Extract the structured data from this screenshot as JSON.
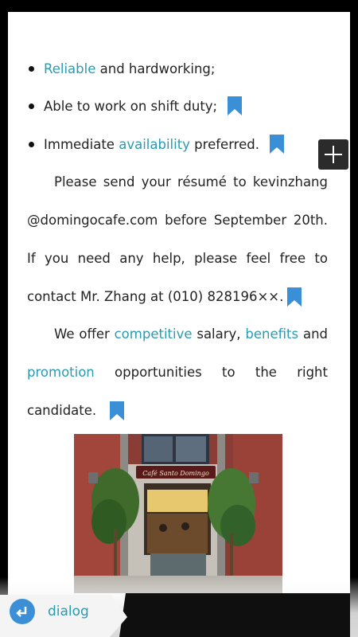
{
  "bullets": [
    {
      "pre": "",
      "kw": "Reliable",
      "post": " and hardworking;",
      "bookmark": false
    },
    {
      "pre": "Able to work on shift duty;",
      "kw": "",
      "post": "",
      "bookmark": true
    },
    {
      "pre": "Immediate ",
      "kw": "availability",
      "post": " preferred.",
      "bookmark": true
    }
  ],
  "para1": {
    "line1": "Please send your résumé to kevinzhang",
    "line2": "@domingocafe.com before September 20th.",
    "line3": "If you need any help, please feel free to",
    "line4": "contact Mr. Zhang at (010) 828196××."
  },
  "para2": {
    "l1_pre": "We offer ",
    "l1_kw1": "competitive",
    "l1_mid": " salary, ",
    "l1_kw2": "benefits",
    "l1_post": " and",
    "l2_kw": "promotion",
    "l2_w1": "opportunities",
    "l2_w2": "to",
    "l2_w3": "the",
    "l2_w4": "right",
    "l3": "candidate."
  },
  "photo": {
    "sign": "Café Santo Domingo"
  },
  "nav": {
    "dialog_label": "dialog"
  },
  "colors": {
    "keyword": "#2a9bb0",
    "bookmark": "#3a8fd6"
  }
}
